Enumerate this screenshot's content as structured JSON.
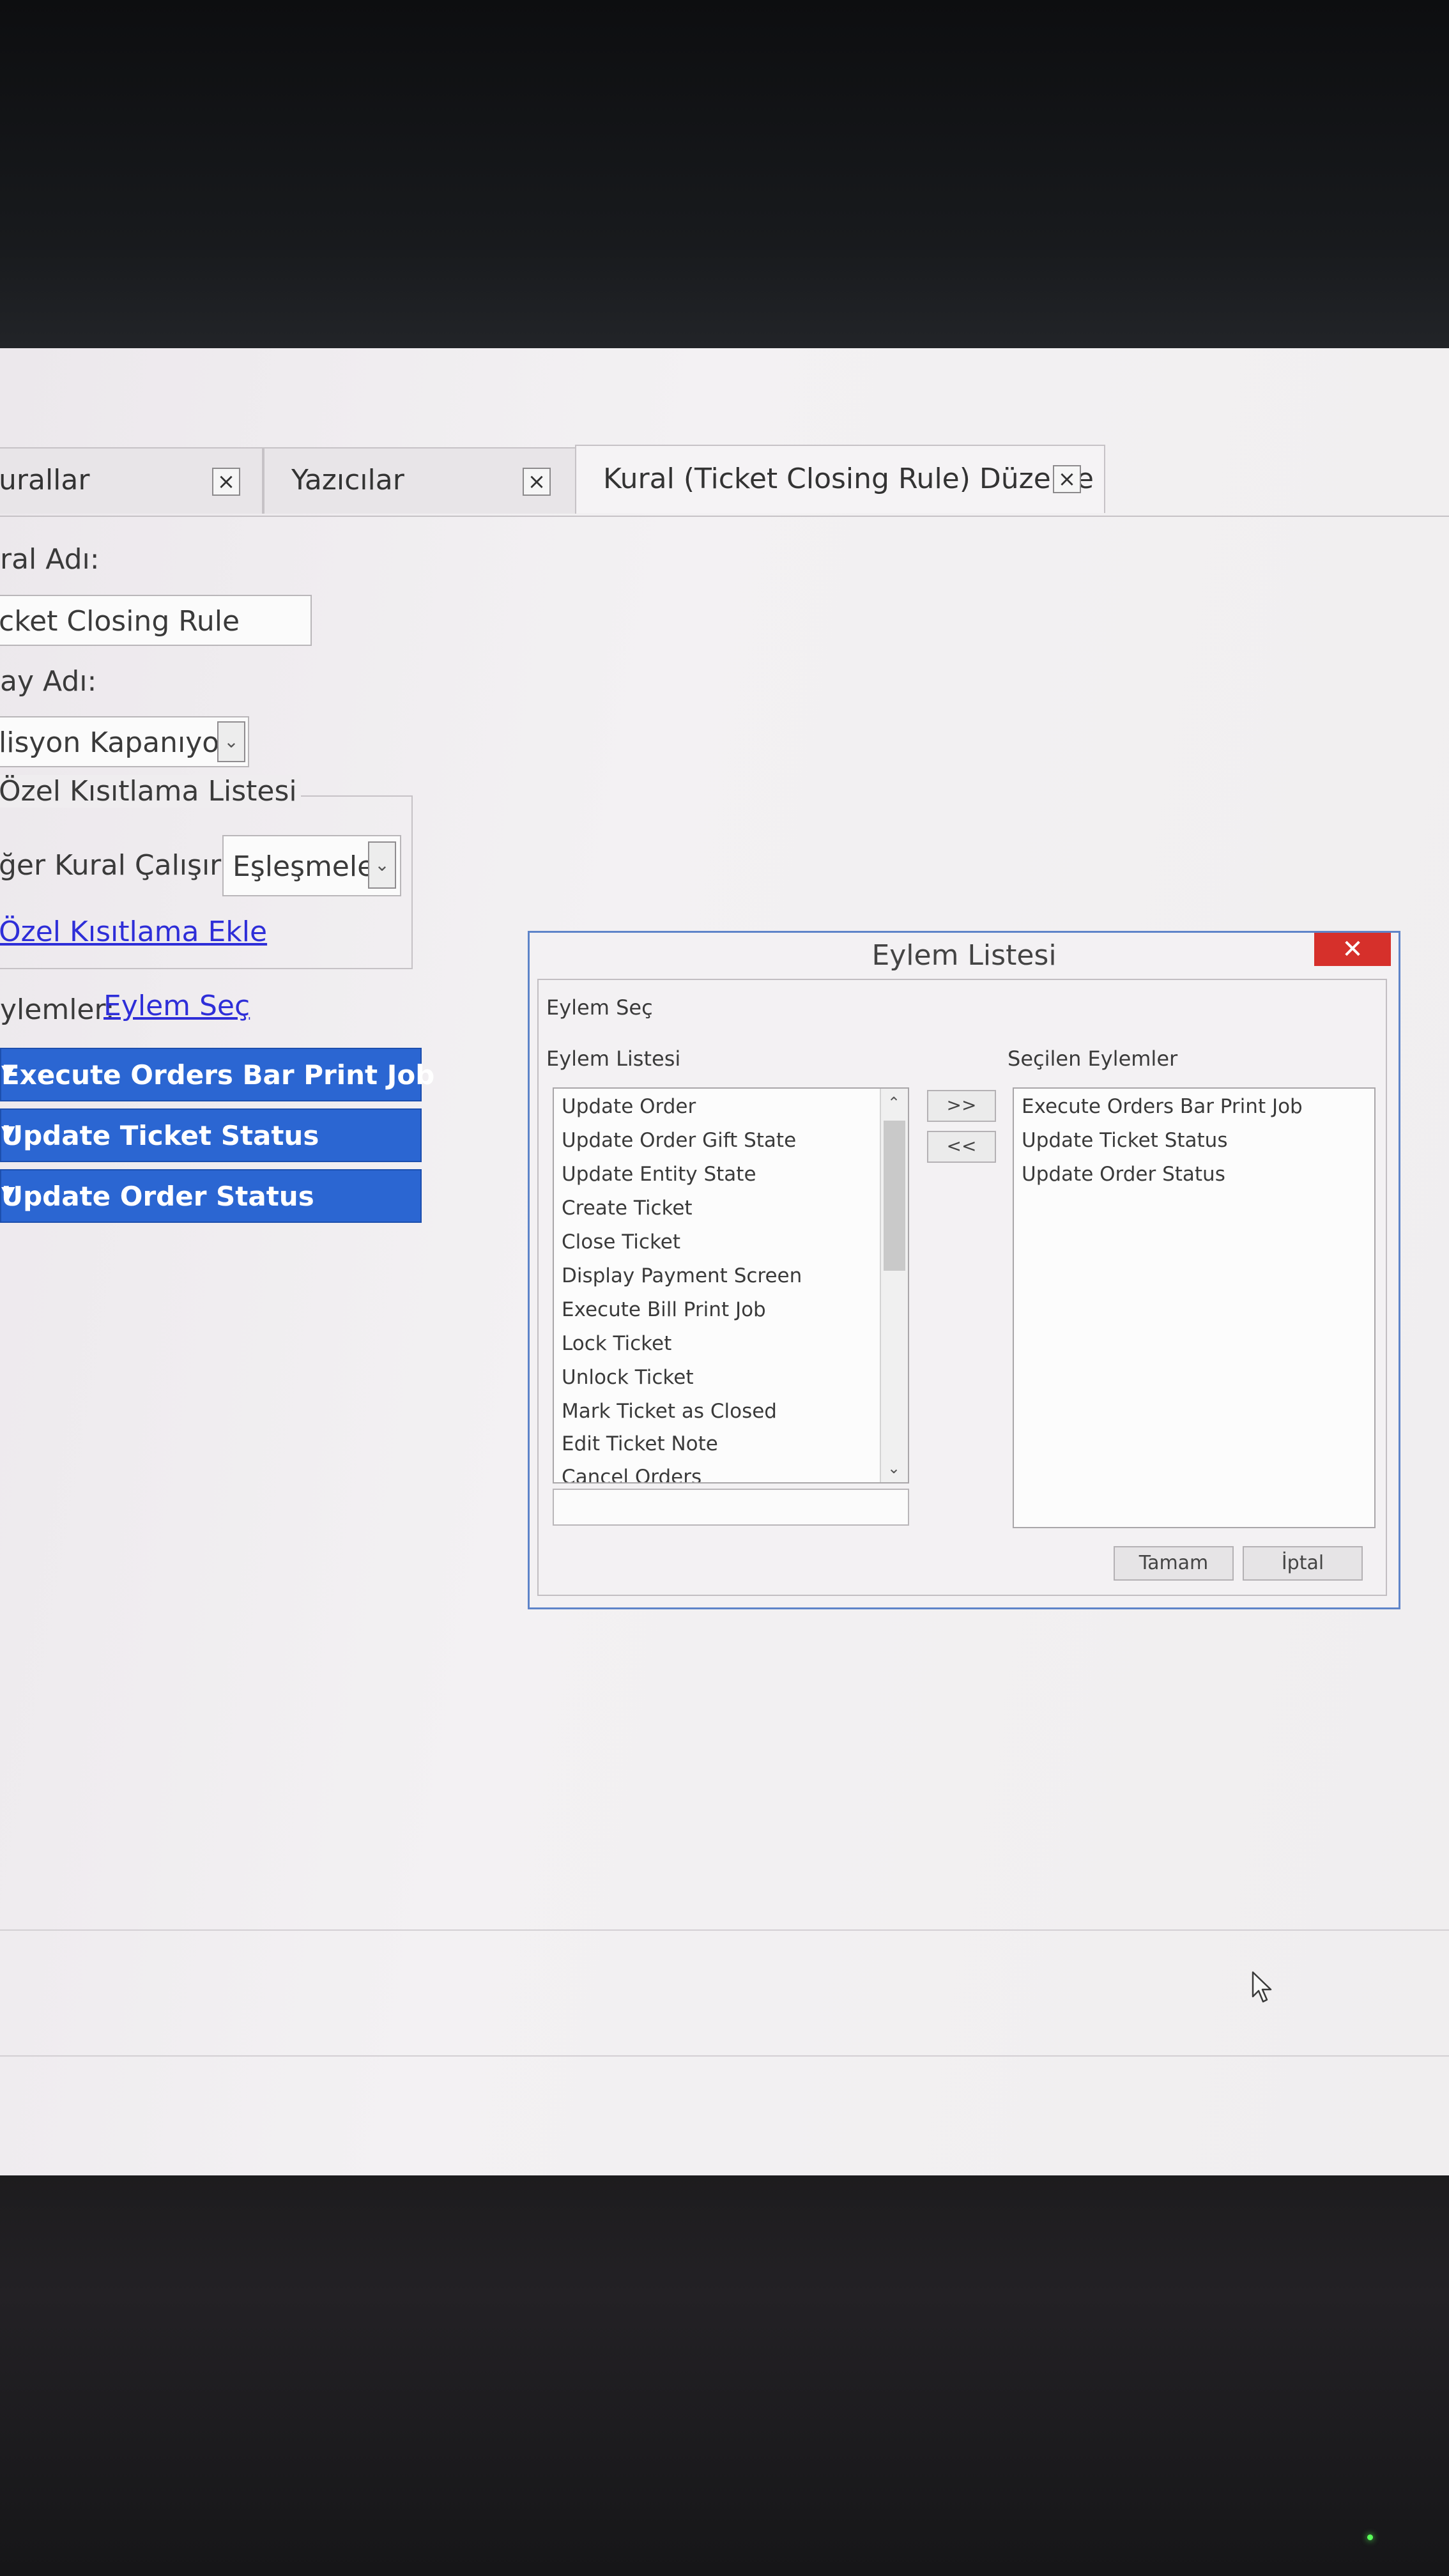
{
  "tabs": [
    {
      "label": "urallar",
      "close": "×"
    },
    {
      "label": "Yazıcılar",
      "close": "×"
    },
    {
      "label": "Kural (Ticket Closing Rule) Düzenle",
      "close": "×"
    }
  ],
  "form": {
    "rule_name_label": "ral Adı:",
    "rule_name_value": "cket Closing Rule",
    "event_name_label": "ay Adı:",
    "event_name_value": "lisyon Kapanıyor",
    "constraint_group_title": "Özel Kısıtlama Listesi",
    "other_rule_label": "ğer Kural Çalışırsa",
    "other_rule_value": "Eşleşmeler",
    "add_constraint_link": "Özel Kısıtlama Ekle",
    "actions_label": "ylemler:",
    "select_action_link": "Eylem Seç",
    "action_buttons": [
      "Execute Orders Bar Print Job",
      "Update Ticket Status",
      "Update Order Status"
    ]
  },
  "dialog": {
    "title": "Eylem Listesi",
    "close": "✕",
    "section_label": "Eylem Seç",
    "available_label": "Eylem Listesi",
    "selected_label": "Seçilen Eylemler",
    "available_items": [
      "Update Order",
      "Update Order Gift State",
      "Update Entity State",
      "Create Ticket",
      "Close Ticket",
      "Display Payment Screen",
      "Execute Bill Print Job",
      "Lock Ticket",
      "Unlock Ticket",
      "Mark Ticket as Closed",
      "Edit Ticket Note",
      "Cancel Orders"
    ],
    "selected_items": [
      "Execute Orders Bar Print Job",
      "Update Ticket Status",
      "Update Order Status"
    ],
    "add_button": ">>",
    "remove_button": "<<",
    "ok_button": "Tamam",
    "cancel_button": "İptal"
  },
  "icons": {
    "dropdown": "chevron-down-icon",
    "cursor": "mouse-pointer-icon"
  },
  "colors": {
    "action_button_bg": "#2b66d2",
    "dialog_border": "#5e84c9",
    "dialog_close_bg": "#d6302b",
    "link": "#2e2ed8"
  }
}
